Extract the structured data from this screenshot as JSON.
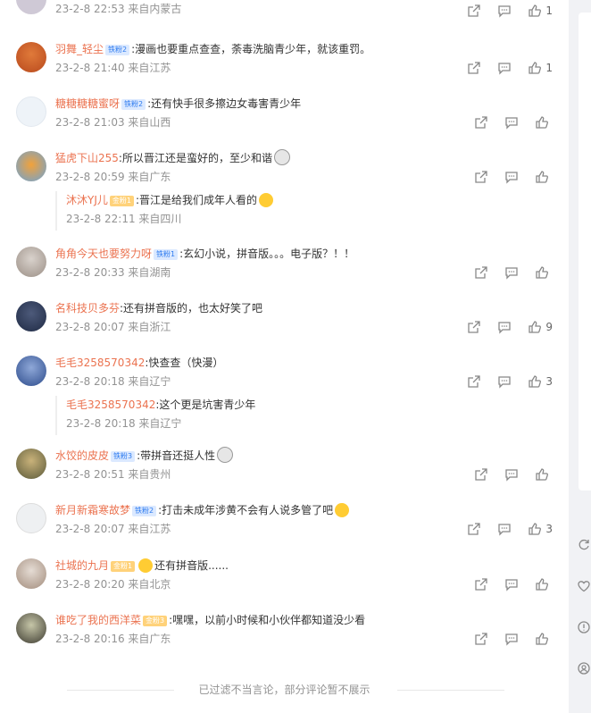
{
  "comments": [
    {
      "meta": "23-2-8 22:53 来自内蒙古",
      "likes": "1"
    },
    {
      "user": "羽舞_轻尘",
      "badge": "铁粉2",
      "text": ":漫画也要重点查查，荼毒洗脑青少年，就该重罚。",
      "meta": "23-2-8 21:40 来自江苏",
      "likes": "1"
    },
    {
      "user": "糖糖糖糖蜜呀",
      "badge": "铁粉2",
      "text": ":还有快手很多擦边女毒害青少年",
      "meta": "23-2-8 21:03 来自山西",
      "likes": ""
    },
    {
      "user": "猛虎下山255",
      "text": ":所以晋江还是蛮好的，至少和谐",
      "meta": "23-2-8 20:59 来自广东",
      "likes": ""
    },
    {
      "user": "角角今天也要努力呀",
      "badge": "铁粉1",
      "text": ":玄幻小说，拼音版。。。电子版？！！",
      "meta": "23-2-8 20:33 来自湖南",
      "likes": ""
    },
    {
      "user": "名科技贝多芬",
      "text": ":还有拼音版的，也太好笑了吧",
      "meta": "23-2-8 20:07 来自浙江",
      "likes": "9"
    },
    {
      "user": "毛毛3258570342",
      "text": ":快查查（快漫）",
      "meta": "23-2-8 20:18 来自辽宁",
      "likes": "3"
    },
    {
      "user": "水饺的皮皮",
      "badge": "铁粉3",
      "text": ":带拼音还挺人性",
      "meta": "23-2-8 20:51 来自贵州",
      "likes": ""
    },
    {
      "user": "新月新霜寒故梦",
      "badge": "铁粉2",
      "text": ":打击未成年涉黄不会有人说多管了吧",
      "meta": "23-2-8 20:07 来自江苏",
      "likes": "3"
    },
    {
      "user": "社城的九月",
      "badge": "金粉1",
      "text": "还有拼音版......",
      "meta": "23-2-8 20:20 来自北京",
      "likes": ""
    },
    {
      "user": "谁吃了我的西洋菜",
      "badge": "金粉3",
      "text": ":嘿嘿，以前小时候和小伙伴都知道没少看",
      "meta": "23-2-8 20:16 来自广东",
      "likes": ""
    }
  ],
  "replies": [
    {
      "user": "沐沐YJ儿",
      "badge": "金粉1",
      "text": ":晋江是给我们成年人看的",
      "meta": "23-2-8 22:11 来自四川"
    },
    {
      "user": "毛毛3258570342",
      "text": ":这个更是坑害青少年",
      "meta": "23-2-8 20:18 来自辽宁"
    }
  ],
  "footer_text": "已过滤不当言论，部分评论暂不展示",
  "colors": {
    "username": "#eb7350",
    "meta": "#939393",
    "badge_blue": "#2f7cf0",
    "badge_gold": "#ffd27a"
  },
  "icons": [
    "share-icon",
    "comment-icon",
    "like-icon",
    "refresh-icon",
    "heart-icon",
    "alert-icon",
    "user-icon"
  ]
}
